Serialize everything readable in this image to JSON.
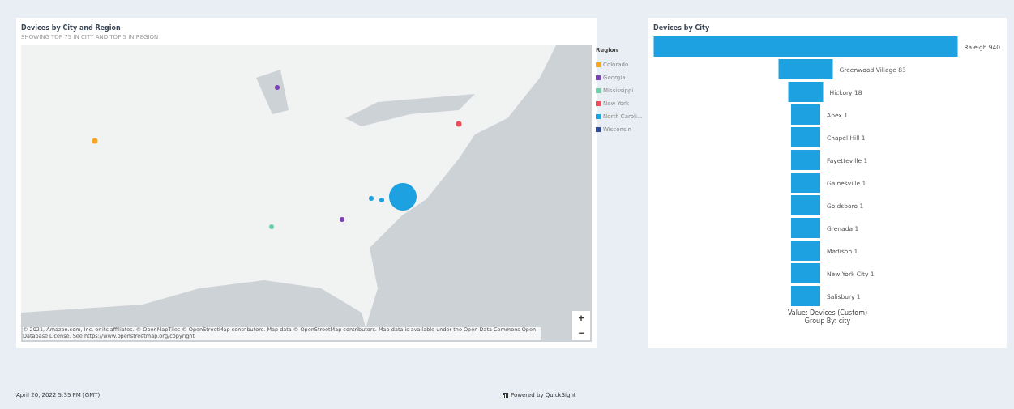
{
  "map_visual": {
    "title": "Devices by City and Region",
    "subtitle": "SHOWING TOP 75 IN CITY AND TOP 5 IN REGION",
    "legend": {
      "title": "Region",
      "items": [
        {
          "label": "Colorado",
          "color": "#f5a623"
        },
        {
          "label": "Georgia",
          "color": "#7b3fb8"
        },
        {
          "label": "Mississippi",
          "color": "#6fd1a9"
        },
        {
          "label": "New York",
          "color": "#e8505b"
        },
        {
          "label": "North Caroli...",
          "color": "#1ea1e0"
        },
        {
          "label": "Wisconsin",
          "color": "#2d4a9a"
        }
      ]
    },
    "zoom_in": "+",
    "zoom_out": "−",
    "attribution": "© 2021, Amazon.com, Inc. or its affiliates. © OpenMapTiles © OpenStreetMap contributors. Map data © OpenStreetMap contributors. Map data is available under the Open Data Commons Open Database License. See https://www.openstreetmap.org/copyright"
  },
  "bar_visual": {
    "title": "Devices by City",
    "stages": [
      {
        "label": "Raleigh 940"
      },
      {
        "label": "Greenwood Village 83"
      },
      {
        "label": "Hickory 18"
      },
      {
        "label": "Apex 1"
      },
      {
        "label": "Chapel Hill 1"
      },
      {
        "label": "Fayetteville 1"
      },
      {
        "label": "Gainesville 1"
      },
      {
        "label": "Goldsboro 1"
      },
      {
        "label": "Grenada 1"
      },
      {
        "label": "Madison 1"
      },
      {
        "label": "New York City 1"
      },
      {
        "label": "Salisbury 1"
      }
    ],
    "value_caption": "Value: Devices (Custom)",
    "group_caption": "Group By: city"
  },
  "footer": {
    "timestamp": "April 20, 2022 5:35 PM (GMT)",
    "powered_by": "Powered by QuickSight"
  }
}
